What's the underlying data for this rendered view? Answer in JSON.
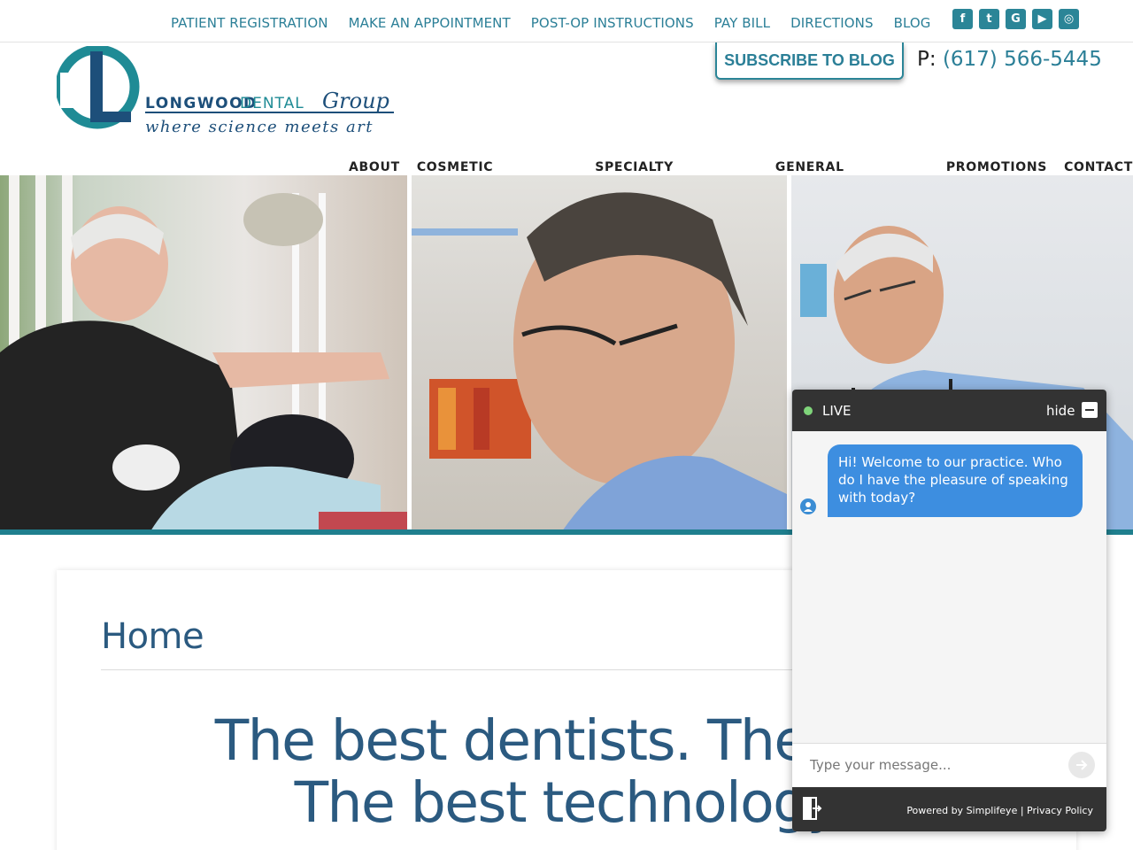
{
  "topbar": {
    "links": [
      "PATIENT REGISTRATION",
      "MAKE AN APPOINTMENT",
      "POST-OP INSTRUCTIONS",
      "PAY BILL",
      "DIRECTIONS",
      "BLOG"
    ],
    "social": [
      {
        "icon": "facebook-icon",
        "glyph": "f"
      },
      {
        "icon": "twitter-icon",
        "glyph": "t"
      },
      {
        "icon": "google-my-business-icon",
        "glyph": "G"
      },
      {
        "icon": "youtube-icon",
        "glyph": "▶"
      },
      {
        "icon": "instagram-icon",
        "glyph": "◎"
      }
    ]
  },
  "header": {
    "logo_name": "LONGWOOD DENTAL GROUP",
    "logo_tagline": "where science meets art",
    "subscribe_label": "SUBSCRIBE TO BLOG",
    "phone_label": "P:",
    "phone_number": "(617) 566-5445"
  },
  "nav": [
    "ABOUT",
    "COSMETIC DENTISTRY",
    "SPECIALTY DENTISTRY",
    "GENERAL DENTISTRY",
    "PROMOTIONS",
    "CONTACT"
  ],
  "main": {
    "page_title": "Home",
    "headline_line1": "The best dentists. The bes",
    "headline_line2": "The best technology"
  },
  "chat": {
    "status": "LIVE",
    "hide_label": "hide",
    "message": "Hi! Welcome to our practice.  Who do I have the pleasure of speaking with today?",
    "input_placeholder": "Type your message...",
    "powered_by": "Powered by Simplifeye | Privacy Policy"
  },
  "colors": {
    "teal": "#2b7f97",
    "navy": "#2b5a80",
    "chat_dark": "#333333",
    "bubble": "#3d8ee0"
  }
}
